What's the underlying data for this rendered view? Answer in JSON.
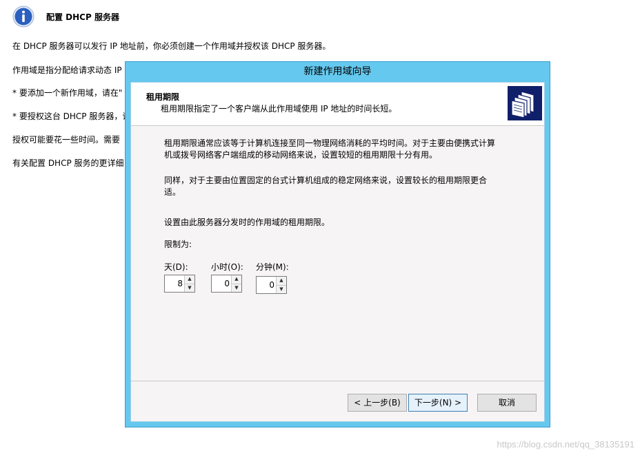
{
  "background": {
    "title": "配置 DHCP 服务器",
    "lines": [
      "在 DHCP 服务器可以发行 IP 地址前，你必须创建一个作用域并授权该 DHCP 服务器。",
      "作用域是指分配给请求动态 IP",
      "* 要添加一个新作用域，请在\"",
      "* 要授权这台 DHCP 服务器，请",
      "授权可能要花一些时间。需要",
      "有关配置 DHCP 服务的更详细"
    ]
  },
  "wizard": {
    "window_title": "新建作用域向导",
    "header": {
      "title": "租用期限",
      "subtitle": "租用期限指定了一个客户端从此作用域使用 IP 地址的时间长短。",
      "icon": "folders-icon"
    },
    "paragraphs": {
      "p1_line1": "租用期限通常应该等于计算机连接至同一物理网络消耗的平均时间。对于主要由便携式计算",
      "p1_line2": "机或拨号网络客户端组成的移动网络来说，设置较短的租用期限十分有用。",
      "p2_line1": "同样，对于主要由位置固定的台式计算机组成的稳定网络来说，设置较长的租用期限更合",
      "p2_line2": "适。",
      "p3": "设置由此服务器分发时的作用域的租用期限。",
      "limit_label": "限制为:"
    },
    "fields": {
      "days_label": "天(D):",
      "days_value": "8",
      "hours_label": "小时(O):",
      "hours_value": "0",
      "minutes_label": "分钟(M):",
      "minutes_value": "0"
    },
    "buttons": {
      "back": "< 上一步(B)",
      "next": "下一步(N) >",
      "cancel": "取消"
    }
  },
  "watermark": "https://blog.csdn.net/qq_38135191",
  "colors": {
    "title_bar": "#65c8ee",
    "header_icon_bg": "#0f1f6a",
    "info_icon": "#2a5fbf"
  }
}
